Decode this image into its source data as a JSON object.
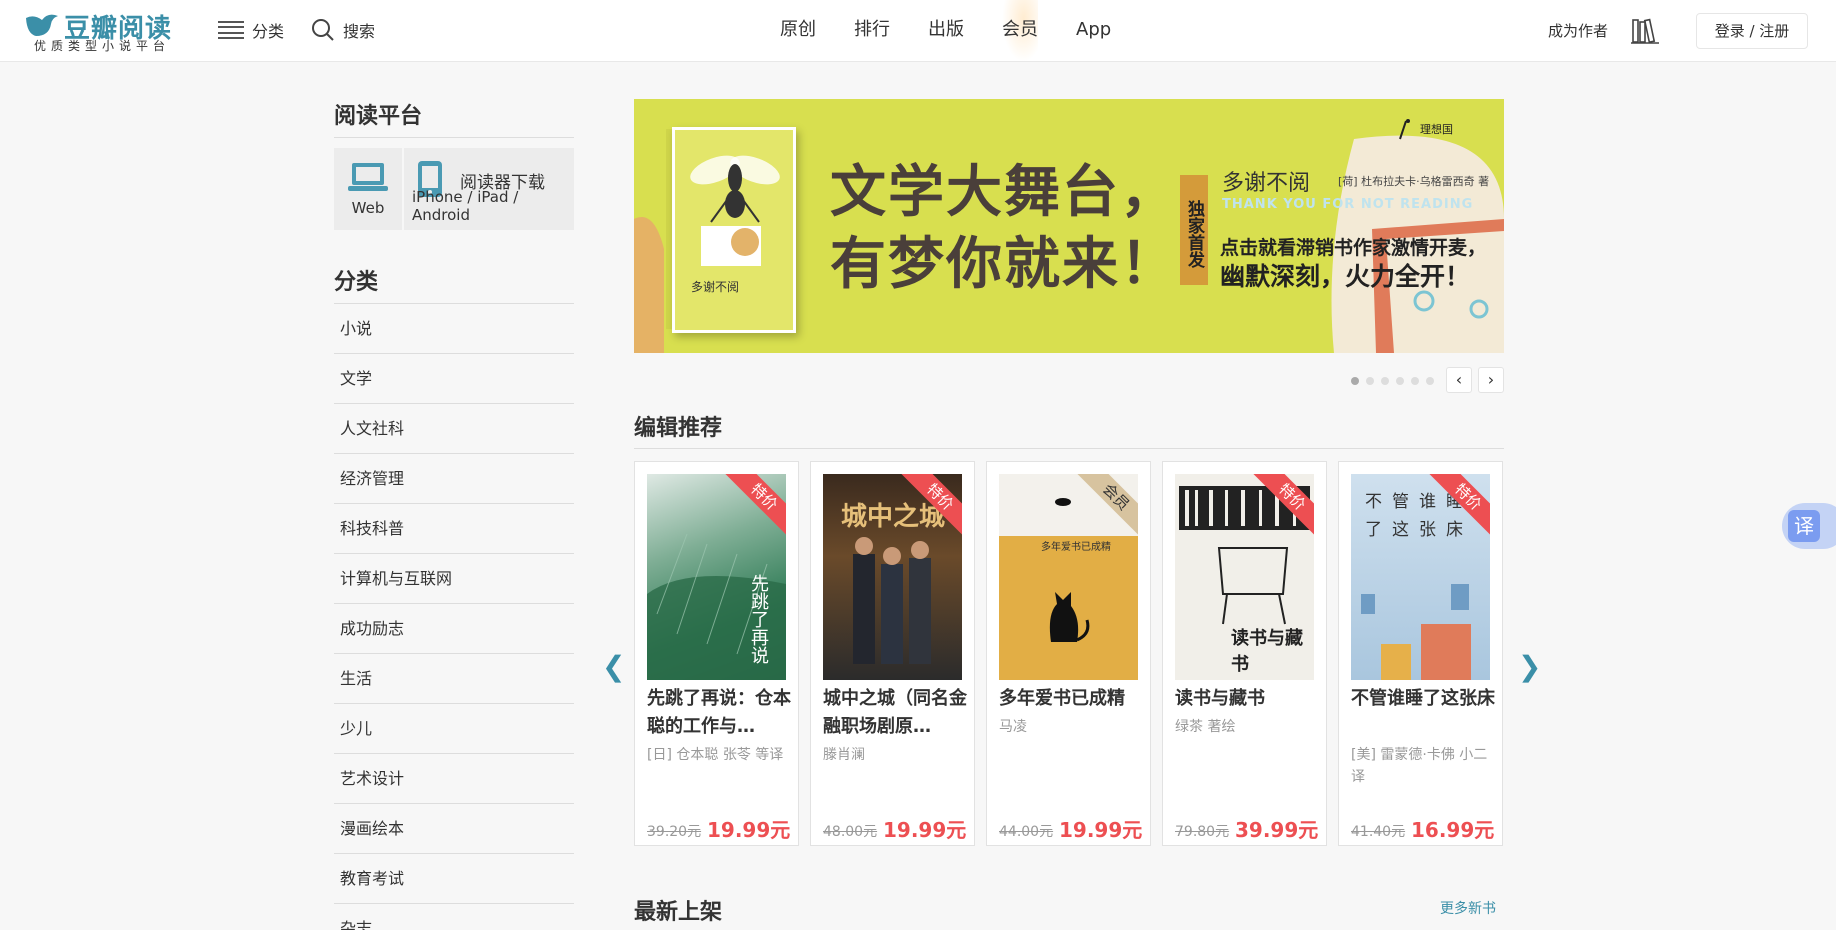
{
  "header": {
    "logo_brand": "豆瓣阅读",
    "logo_slogan": "优质类型小说平台",
    "category_label": "分类",
    "search_label": "搜索",
    "nav": [
      "原创",
      "排行",
      "出版",
      "会员",
      "App"
    ],
    "become_author": "成为作者",
    "login_label": "登录 / 注册"
  },
  "sidebar": {
    "platform_title": "阅读平台",
    "web_label": "Web",
    "download_label": "阅读器下载",
    "devices_label": "iPhone / iPad / Android",
    "category_title": "分类",
    "categories": [
      "小说",
      "文学",
      "人文社科",
      "经济管理",
      "科技科普",
      "计算机与互联网",
      "成功励志",
      "生活",
      "少儿",
      "艺术设计",
      "漫画绘本",
      "教育考试",
      "杂志"
    ]
  },
  "banner": {
    "headline_line1": "文学大舞台，",
    "headline_line2": "有梦你就来！",
    "tag": "独家首发",
    "book_name": "多谢不阅",
    "book_author": "[荷] 杜布拉夫卡·乌格雷西奇 著",
    "book_en": "THANK YOU FOR NOT READING",
    "promo_line1": "点击就看滞销书作家激情开麦，",
    "promo_line2": "幽默深刻，火力全开！",
    "publisher": "理想国",
    "cover_title": "多谢不阅",
    "slide_count": 6,
    "active_slide": 0
  },
  "picks": {
    "title": "编辑推荐",
    "books": [
      {
        "title": "先跳了再说：仓本聪的工作与…",
        "author": "[日] 仓本聪 张苓 等译",
        "old_price": "39.20元",
        "new_price": "19.99元",
        "badge": "特价",
        "cover_text": "先跳了再说"
      },
      {
        "title": "城中之城（同名金融职场剧原…",
        "author": "滕肖澜",
        "old_price": "48.00元",
        "new_price": "19.99元",
        "badge": "特价",
        "cover_text": "城中之城"
      },
      {
        "title": "多年爱书已成精",
        "author": "马凌",
        "old_price": "44.00元",
        "new_price": "19.99元",
        "badge": "会员",
        "cover_text": "多年爱书已成精"
      },
      {
        "title": "读书与藏书",
        "author": "绿茶 著绘",
        "old_price": "79.80元",
        "new_price": "39.99元",
        "badge": "特价",
        "cover_text": "读书与藏书"
      },
      {
        "title": "不管谁睡了这张床",
        "author": "[美] 雷蒙德·卡佛 小二译",
        "old_price": "41.40元",
        "new_price": "16.99元",
        "badge": "特价",
        "cover_text": "不管谁睡了这张床"
      }
    ]
  },
  "latest": {
    "title": "最新上架",
    "more_label": "更多新书"
  },
  "floating": {
    "translate_label": "译"
  },
  "colors": {
    "accent": "#3b8fa8",
    "price": "#ed4f52",
    "banner_bg": "#d8df4f"
  }
}
